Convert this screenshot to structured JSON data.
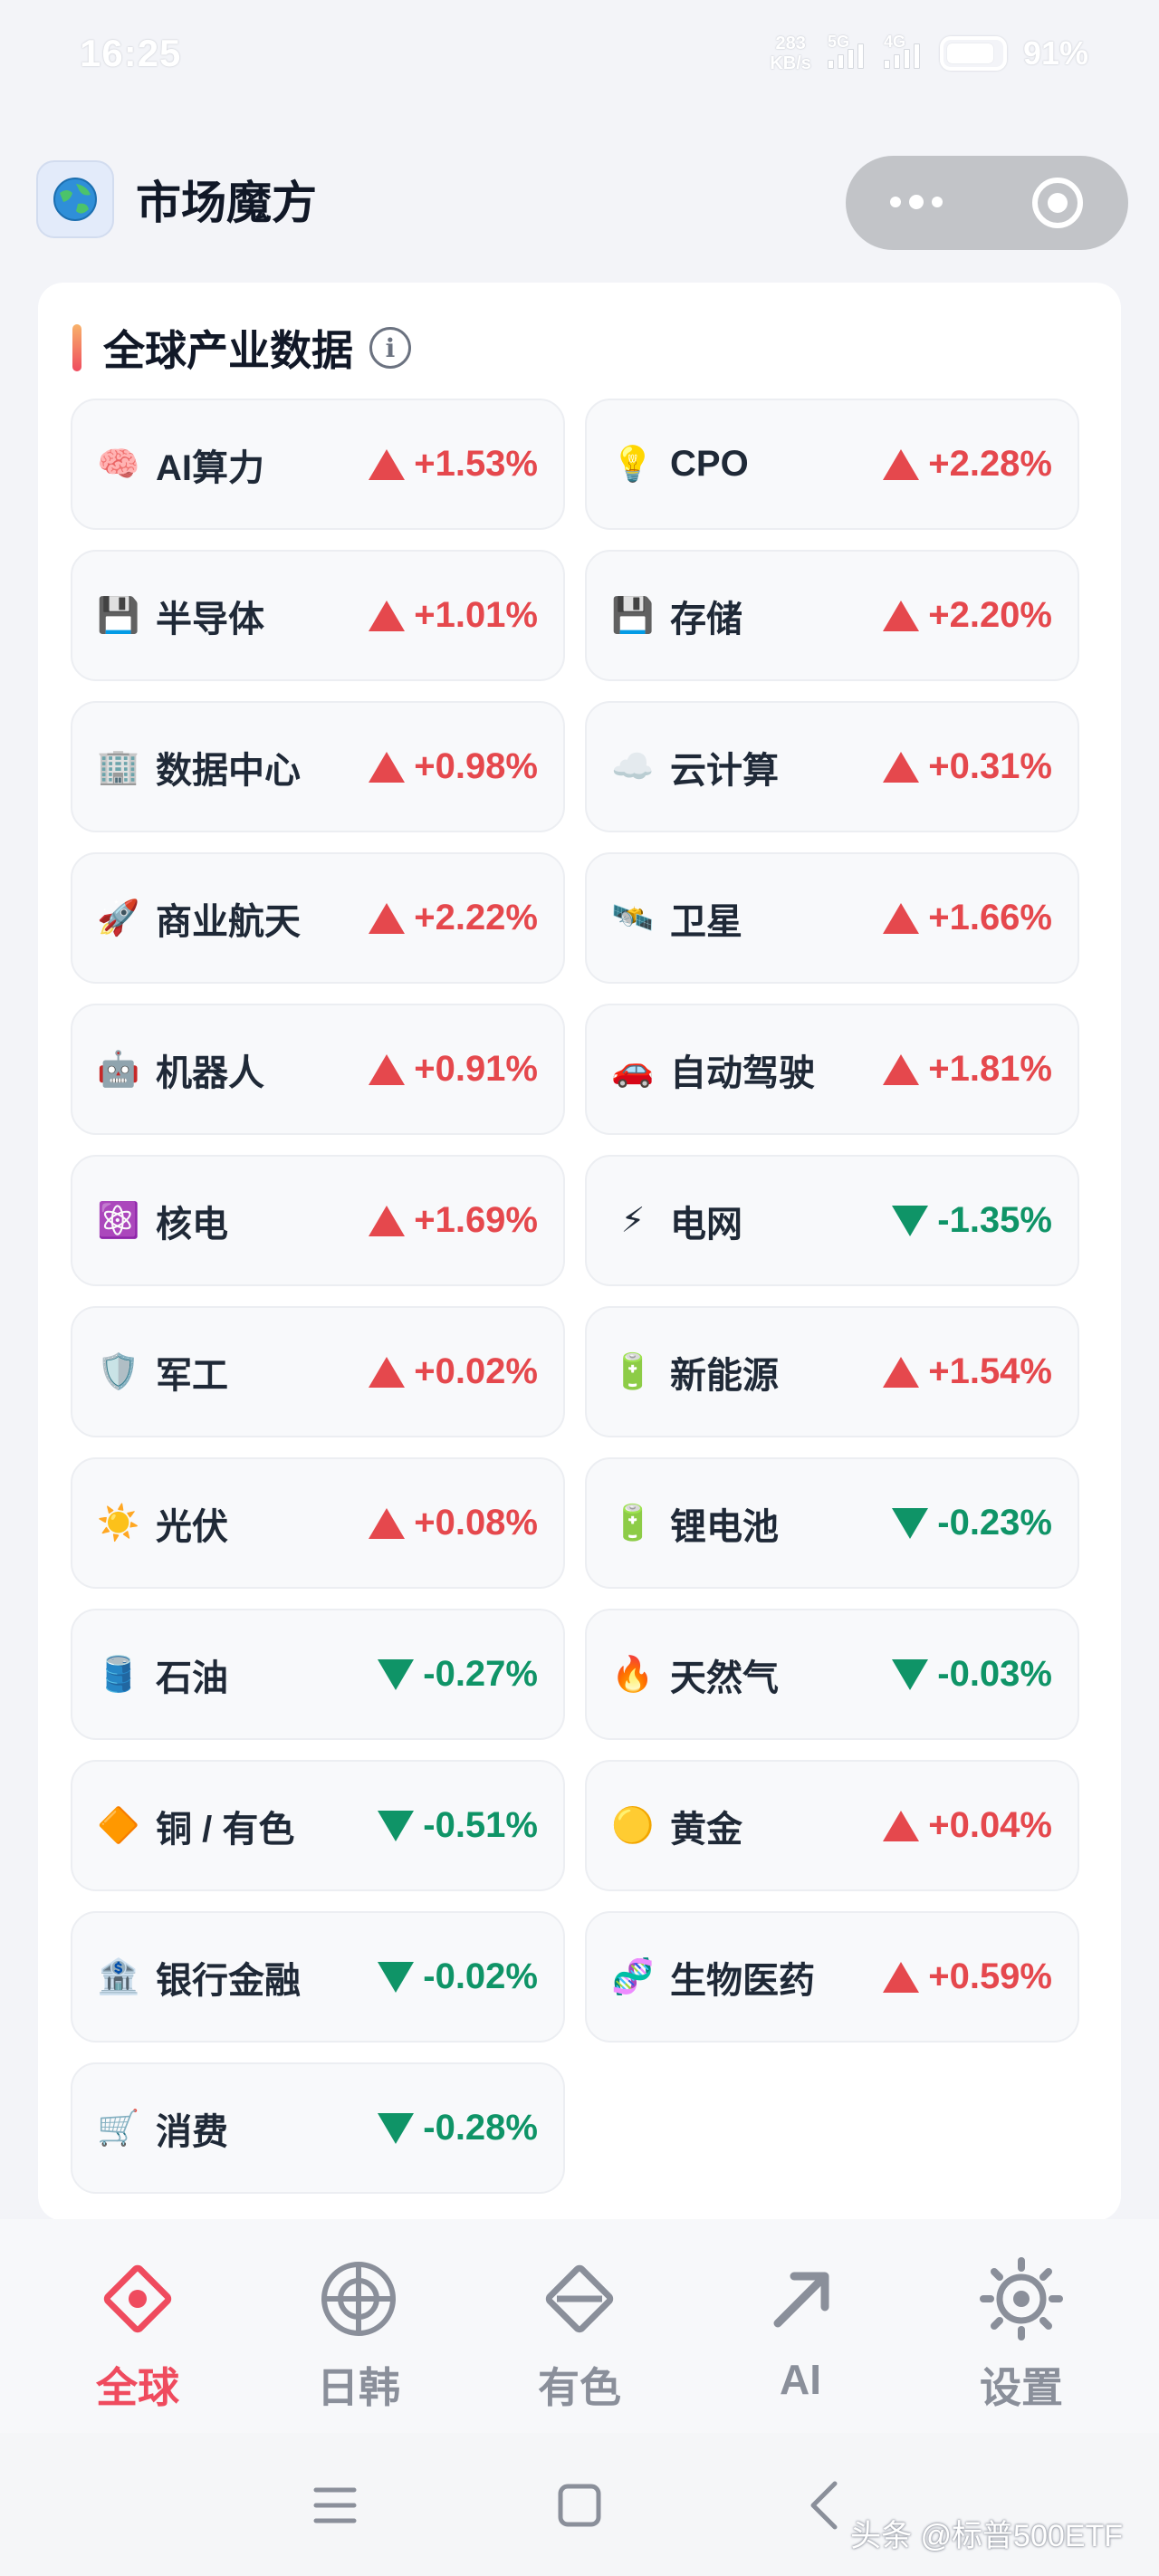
{
  "status": {
    "time": "16:25",
    "net_speed": "283",
    "net_speed_unit": "KB/s",
    "sig1_label": "5G",
    "sig2_label": "4G",
    "battery": "91%"
  },
  "app": {
    "title": "市场魔方",
    "logo_icon": "globe-icon"
  },
  "section": {
    "title": "全球产业数据",
    "info_glyph": "i"
  },
  "colors": {
    "up": "#e5484d",
    "down": "#0f9467",
    "accent": "#ef4b5e"
  },
  "industries": [
    {
      "emoji": "🧠",
      "name": "AI算力",
      "change": "+1.53%",
      "dir": "up"
    },
    {
      "emoji": "💡",
      "name": "CPO",
      "change": "+2.28%",
      "dir": "up"
    },
    {
      "emoji": "💾",
      "name": "半导体",
      "change": "+1.01%",
      "dir": "up"
    },
    {
      "emoji": "💾",
      "name": "存储",
      "change": "+2.20%",
      "dir": "up"
    },
    {
      "emoji": "🏢",
      "name": "数据中心",
      "change": "+0.98%",
      "dir": "up"
    },
    {
      "emoji": "☁️",
      "name": "云计算",
      "change": "+0.31%",
      "dir": "up"
    },
    {
      "emoji": "🚀",
      "name": "商业航天",
      "change": "+2.22%",
      "dir": "up"
    },
    {
      "emoji": "🛰️",
      "name": "卫星",
      "change": "+1.66%",
      "dir": "up"
    },
    {
      "emoji": "🤖",
      "name": "机器人",
      "change": "+0.91%",
      "dir": "up"
    },
    {
      "emoji": "🚗",
      "name": "自动驾驶",
      "change": "+1.81%",
      "dir": "up"
    },
    {
      "emoji": "⚛️",
      "name": "核电",
      "change": "+1.69%",
      "dir": "up"
    },
    {
      "emoji": "⚡",
      "name": "电网",
      "change": "-1.35%",
      "dir": "down"
    },
    {
      "emoji": "🛡️",
      "name": "军工",
      "change": "+0.02%",
      "dir": "up"
    },
    {
      "emoji": "🔋",
      "name": "新能源",
      "change": "+1.54%",
      "dir": "up"
    },
    {
      "emoji": "☀️",
      "name": "光伏",
      "change": "+0.08%",
      "dir": "up"
    },
    {
      "emoji": "🔋",
      "name": "锂电池",
      "change": "-0.23%",
      "dir": "down"
    },
    {
      "emoji": "🛢️",
      "name": "石油",
      "change": "-0.27%",
      "dir": "down"
    },
    {
      "emoji": "🔥",
      "name": "天然气",
      "change": "-0.03%",
      "dir": "down"
    },
    {
      "emoji": "🔶",
      "name": "铜 / 有色",
      "change": "-0.51%",
      "dir": "down"
    },
    {
      "emoji": "🟡",
      "name": "黄金",
      "change": "+0.04%",
      "dir": "up"
    },
    {
      "emoji": "🏦",
      "name": "银行金融",
      "change": "-0.02%",
      "dir": "down"
    },
    {
      "emoji": "🧬",
      "name": "生物医药",
      "change": "+0.59%",
      "dir": "up"
    },
    {
      "emoji": "🛒",
      "name": "消费",
      "change": "-0.28%",
      "dir": "down"
    }
  ],
  "tabs": [
    {
      "id": "global",
      "label": "全球",
      "icon": "diamond-target-icon",
      "active": true
    },
    {
      "id": "japan-korea",
      "label": "日韩",
      "icon": "crosshair-icon",
      "active": false
    },
    {
      "id": "nonferrous",
      "label": "有色",
      "icon": "diamond-line-icon",
      "active": false
    },
    {
      "id": "ai",
      "label": "AI",
      "icon": "arrow-up-right-icon",
      "active": false
    },
    {
      "id": "settings",
      "label": "设置",
      "icon": "gear-icon",
      "active": false
    }
  ],
  "system_nav": {
    "menu_icon": "menu-icon",
    "home_icon": "home-square-icon",
    "back_icon": "back-chevron-icon"
  },
  "watermark": "头条 @标普500ETF"
}
